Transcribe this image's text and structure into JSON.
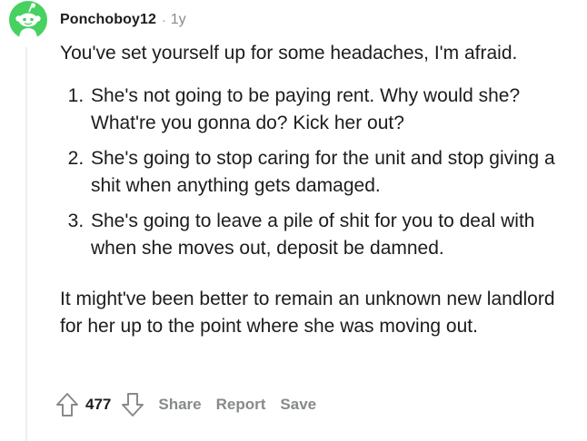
{
  "comment": {
    "author": "Ponchoboy12",
    "separator": "·",
    "age": "1y",
    "intro": "You've set yourself up for some headaches, I'm afraid.",
    "list_items": [
      "She's not going to be paying rent. Why would she? What're you gonna do? Kick her out?",
      "She's going to stop caring for the unit and stop giving a shit when anything gets damaged.",
      "She's going to leave a pile of shit for you to deal with when she moves out, deposit be damned."
    ],
    "outro": "It might've been better to remain an unknown new landlord for her up to the point where she was moving out."
  },
  "actions": {
    "vote_count": "477",
    "share_label": "Share",
    "report_label": "Report",
    "save_label": "Save"
  },
  "colors": {
    "avatar_bg": "#46d160",
    "text": "#1c1c1c",
    "muted": "#878a8c",
    "thread_line": "#edeff1"
  },
  "icons": {
    "avatar": "snoo-avatar-icon",
    "upvote": "upvote-arrow-icon",
    "downvote": "downvote-arrow-icon"
  }
}
